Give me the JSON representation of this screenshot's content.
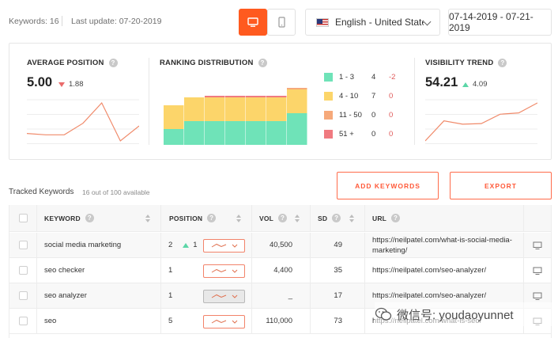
{
  "header": {
    "keywords_label": "Keywords: 16",
    "last_update": "Last update: 07-20-2019",
    "language": "English - United States",
    "date_range": "07-14-2019 - 07-21-2019",
    "active_device": "desktop"
  },
  "average_position": {
    "title": "AVERAGE POSITION",
    "value": "5.00",
    "delta": "1.88",
    "trend": [
      6.1,
      6.3,
      6.3,
      4.6,
      1.6,
      7.2,
      5.0
    ]
  },
  "ranking_distribution": {
    "title": "RANKING DISTRIBUTION",
    "stacks": [
      {
        "top3": 2,
        "top10": 3,
        "top50": 0,
        "top51": 0
      },
      {
        "top3": 3,
        "top10": 3,
        "top50": 0,
        "top51": 0
      },
      {
        "top3": 3,
        "top10": 3,
        "top50": 0,
        "top51": 0.2
      },
      {
        "top3": 3,
        "top10": 3,
        "top50": 0,
        "top51": 0.2
      },
      {
        "top3": 3,
        "top10": 3,
        "top50": 0,
        "top51": 0.2
      },
      {
        "top3": 3,
        "top10": 3,
        "top50": 0,
        "top51": 0.2
      },
      {
        "top3": 4,
        "top10": 3,
        "top50": 0.2,
        "top51": 0
      }
    ],
    "legend": [
      {
        "label": "1 - 3",
        "count": "4",
        "delta": "-2",
        "color": "#6fe3b8"
      },
      {
        "label": "4 - 10",
        "count": "7",
        "delta": "0",
        "color": "#fcd56a"
      },
      {
        "label": "11 - 50",
        "count": "0",
        "delta": "0",
        "color": "#f6a97a"
      },
      {
        "label": "51 +",
        "count": "0",
        "delta": "0",
        "color": "#f07a80"
      }
    ]
  },
  "visibility_trend": {
    "title": "VISIBILITY TREND",
    "value": "54.21",
    "delta": "4.09",
    "trend": [
      5,
      35,
      30,
      31,
      45,
      47,
      62
    ]
  },
  "tracked": {
    "title": "Tracked Keywords",
    "subtitle": "16 out of 100 available",
    "add_label": "ADD KEYWORDS",
    "export_label": "EXPORT"
  },
  "table": {
    "columns": {
      "keyword": "KEYWORD",
      "position": "POSITION",
      "vol": "VOL",
      "sd": "SD",
      "url": "URL"
    },
    "rows": [
      {
        "keyword": "social media marketing",
        "position": "2",
        "change": "1",
        "vol": "40,500",
        "sd": "49",
        "url": "https://neilpatel.com/what-is-social-media-marketing/"
      },
      {
        "keyword": "seo checker",
        "position": "1",
        "change": "",
        "vol": "4,400",
        "sd": "35",
        "url": "https://neilpatel.com/seo-analyzer/"
      },
      {
        "keyword": "seo analyzer",
        "position": "1",
        "change": "",
        "vol": "_",
        "sd": "17",
        "url": "https://neilpatel.com/seo-analyzer/"
      },
      {
        "keyword": "seo",
        "position": "5",
        "change": "",
        "vol": "110,000",
        "sd": "73",
        "url": "https://neilpatel.com/what-is-seo/"
      }
    ]
  },
  "watermark": {
    "text": "微信号: youdaoyunnet"
  }
}
